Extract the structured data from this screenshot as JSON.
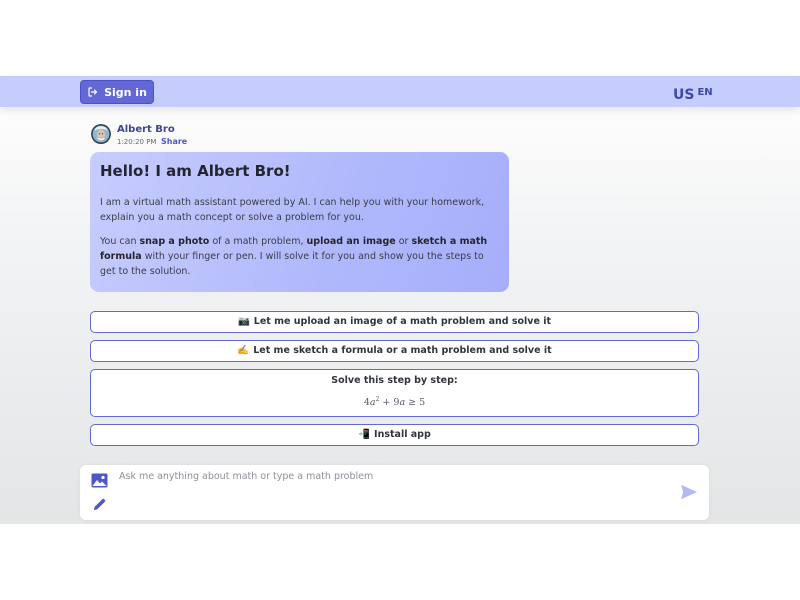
{
  "header": {
    "signin_label": "Sign in",
    "country": "US",
    "language": "EN"
  },
  "bot": {
    "name": "Albert Bro",
    "time": "1:20:20 PM",
    "share_label": "Share"
  },
  "welcome": {
    "title": "Hello! I am Albert Bro!",
    "intro": "I am a virtual math assistant powered by AI. I can help you with your homework, explain you a math concept or solve a problem for you.",
    "p2_part1": "You can ",
    "p2_bold1": "snap a photo",
    "p2_part2": " of a math problem, ",
    "p2_bold2": "upload an image",
    "p2_part3": " or ",
    "p2_bold3": "sketch a math formula",
    "p2_part4": " with your finger or pen. I will solve it for you and show you the steps to get to the solution."
  },
  "actions": {
    "upload": {
      "emoji": "📷",
      "label": "Let me upload an image of a math problem and solve it"
    },
    "sketch": {
      "emoji": "✍️",
      "label": "Let me sketch a formula or a math problem and solve it"
    },
    "solve": {
      "title": "Solve this step by step:",
      "coef1": "4",
      "var1": "a",
      "exp1": "2",
      "plus": " + ",
      "coef2": "9",
      "var2": "a",
      "relation": " ≥ ",
      "rhs": "5"
    },
    "install": {
      "emoji": "📲",
      "label": "Install app"
    }
  },
  "composer": {
    "placeholder": "Ask me anything about math or type a math problem"
  },
  "colors": {
    "accent": "#6368d6",
    "header_bg": "#c5cdfd",
    "bubble_start": "#c7cdfd",
    "bubble_end": "#a6aefb",
    "send_icon": "#b3b8f6"
  },
  "icons": {
    "signin": "sign-in-icon",
    "image": "image-icon",
    "pencil": "pencil-icon",
    "send": "send-icon"
  }
}
